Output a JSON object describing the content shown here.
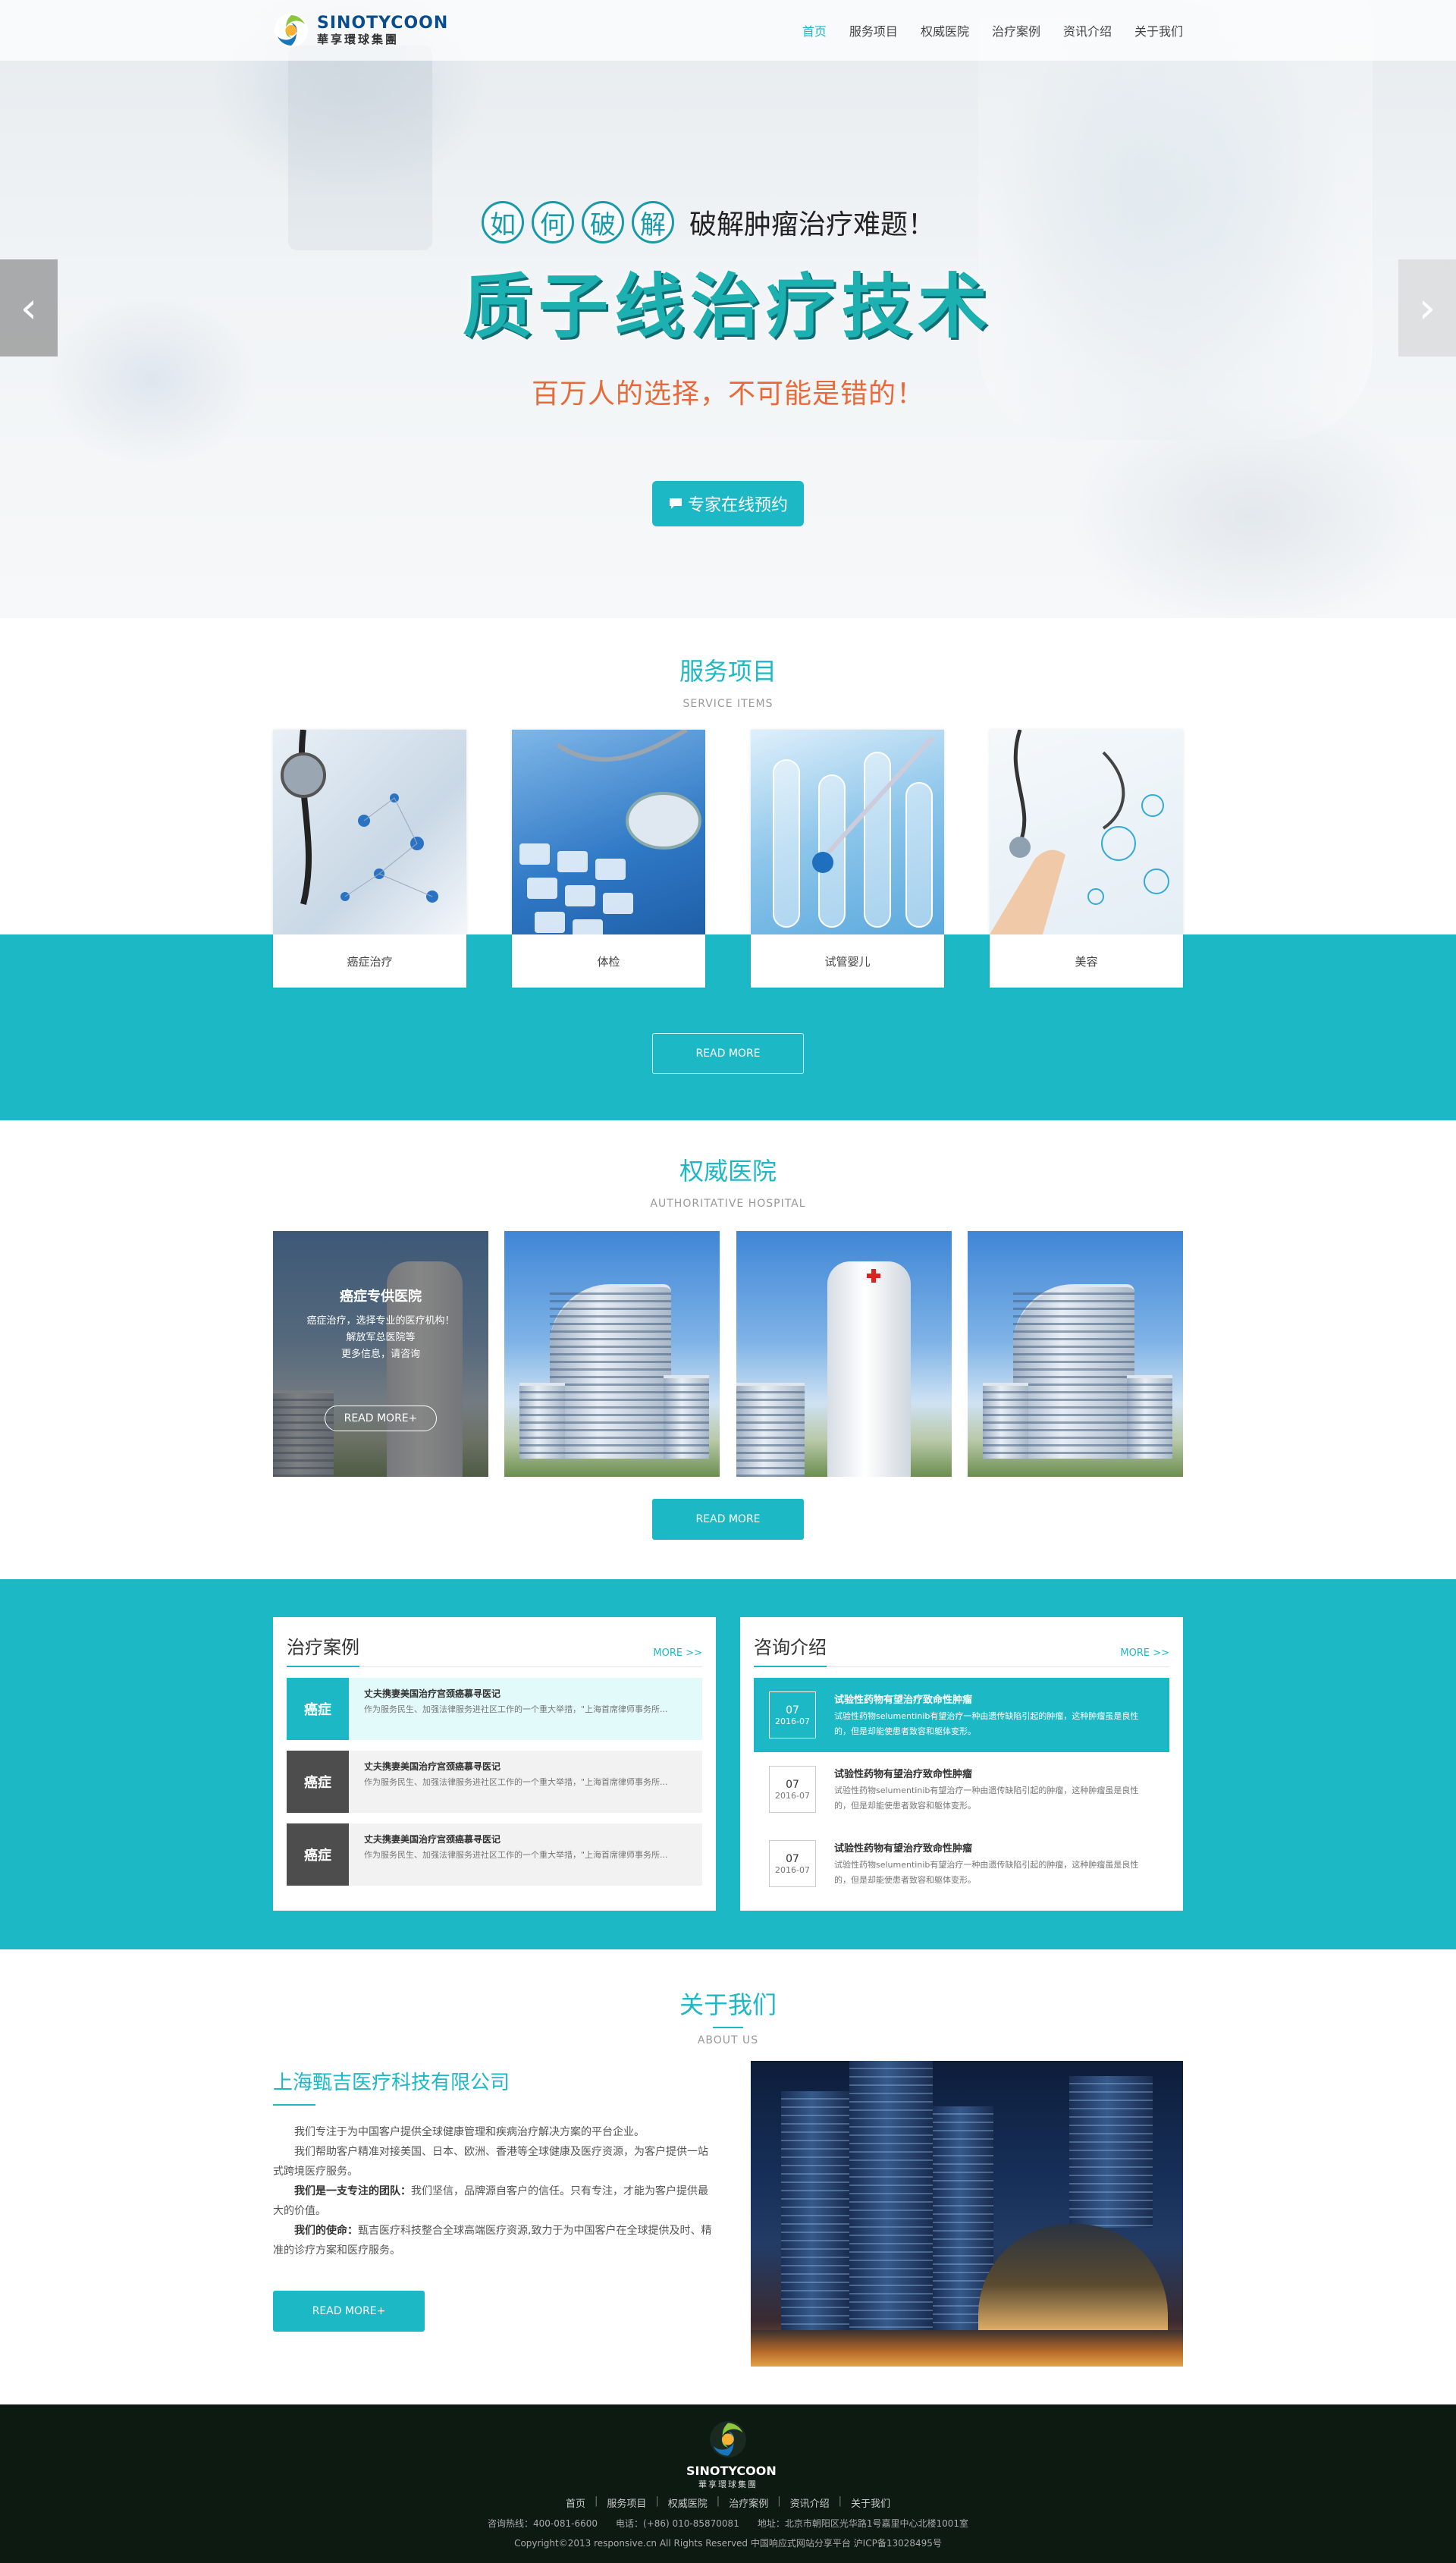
{
  "header": {
    "logo_en": "SINOTYCOON",
    "logo_cn": "華享環球集團",
    "nav": [
      "首页",
      "服务项目",
      "权威医院",
      "治疗案例",
      "资讯介绍",
      "关于我们"
    ],
    "active_nav": "首页",
    "accent_color": "#1db8c6"
  },
  "hero": {
    "ring_chars": [
      "如",
      "何",
      "破",
      "解"
    ],
    "row1_text": "破解肿瘤治疗难题！",
    "title": "质子线治疗技术",
    "subtitle": "百万人的选择，不可能是错的！",
    "button_label": "专家在线预约",
    "button_icon": "chat-icon",
    "prev_icon": "chevron-left-icon",
    "next_icon": "chevron-right-icon",
    "prev_glyph": "‹",
    "next_glyph": "›"
  },
  "services": {
    "title": "服务项目",
    "subtitle": "SERVICE ITEMS",
    "items": [
      {
        "label": "癌症治疗"
      },
      {
        "label": "体检"
      },
      {
        "label": "试管婴儿"
      },
      {
        "label": "美容"
      }
    ],
    "read_more": "READ MORE"
  },
  "hospital": {
    "title": "权威医院",
    "subtitle": "AUTHORITATIVE HOSPITAL",
    "overlay": {
      "title": "癌症专供医院",
      "lines": [
        "癌症治疗，选择专业的医疗机构！",
        "解放军总医院等",
        "更多信息，请咨询"
      ],
      "button": "READ MORE+"
    },
    "read_more": "READ MORE"
  },
  "cases": {
    "title": "治疗案例",
    "more": "MORE >>",
    "items": [
      {
        "tag": "癌症",
        "title": "丈夫携妻美国治疗宫颈癌慕寻医记",
        "text": "作为服务民生、加强法律服务进社区工作的一个重大举措，\"上海首席律师事务所..."
      },
      {
        "tag": "癌症",
        "title": "丈夫携妻美国治疗宫颈癌慕寻医记",
        "text": "作为服务民生、加强法律服务进社区工作的一个重大举措，\"上海首席律师事务所..."
      },
      {
        "tag": "癌症",
        "title": "丈夫携妻美国治疗宫颈癌慕寻医记",
        "text": "作为服务民生、加强法律服务进社区工作的一个重大举措，\"上海首席律师事务所..."
      }
    ]
  },
  "consult": {
    "title": "咨询介绍",
    "more": "MORE >>",
    "items": [
      {
        "day": "07",
        "month": "2016-07",
        "title": "试验性药物有望治疗致命性肿瘤",
        "text": "试验性药物selumentinib有望治疗一种由遗传缺陷引起的肿瘤，这种肿瘤虽是良性的，但是却能使患者致容和躯体变形。"
      },
      {
        "day": "07",
        "month": "2016-07",
        "title": "试验性药物有望治疗致命性肿瘤",
        "text": "试验性药物selumentinib有望治疗一种由遗传缺陷引起的肿瘤，这种肿瘤虽是良性的，但是却能使患者致容和躯体变形。"
      },
      {
        "day": "07",
        "month": "2016-07",
        "title": "试验性药物有望治疗致命性肿瘤",
        "text": "试验性药物selumentinib有望治疗一种由遗传缺陷引起的肿瘤，这种肿瘤虽是良性的，但是却能使患者致容和躯体变形。"
      }
    ]
  },
  "about": {
    "title": "关于我们",
    "subtitle": "ABOUT US",
    "company": "上海甄吉医疗科技有限公司",
    "p1": "我们专注于为中国客户提供全球健康管理和疾病治疗解决方案的平台企业。",
    "p2": "我们帮助客户精准对接美国、日本、欧洲、香港等全球健康及医疗资源，为客户提供一站式跨境医疗服务。",
    "p3_label": "我们是一支专注的团队：",
    "p3": "我们坚信，品牌源自客户的信任。只有专注，才能为客户提供最大的价值。",
    "p4_label": "我们的使命：",
    "p4": "甄吉医疗科技整合全球高端医疗资源,致力于为中国客户在全球提供及时、精准的诊疗方案和医疗服务。",
    "button": "READ MORE+"
  },
  "footer": {
    "logo_en": "SINOTYCOON",
    "logo_cn": "華享環球集團",
    "nav": [
      "首页",
      "服务项目",
      "权威医院",
      "治疗案例",
      "资讯介绍",
      "关于我们"
    ],
    "info": "咨询热线：400-081-6600　　电话：(+86) 010-85870081　　地址：北京市朝阳区光华路1号嘉里中心北楼1001室",
    "copyright": "Copyright©2013 responsive.cn All Rights Reserved 中国响应式网站分享平台 沪ICP备13028495号",
    "bg_color": "#0d1a12"
  }
}
